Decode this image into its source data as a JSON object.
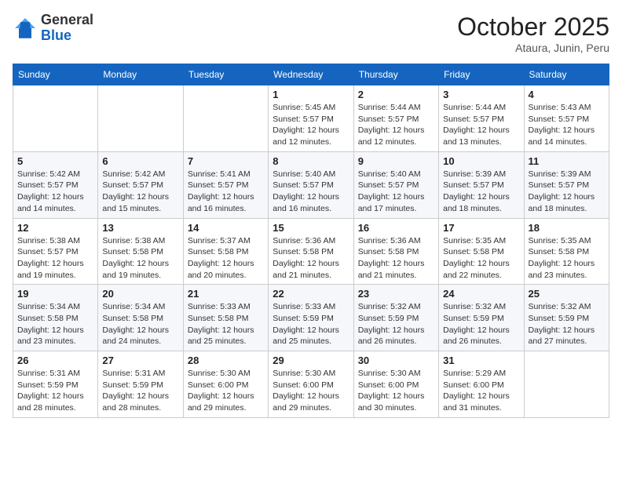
{
  "header": {
    "logo_general": "General",
    "logo_blue": "Blue",
    "month_title": "October 2025",
    "location": "Ataura, Junin, Peru"
  },
  "weekdays": [
    "Sunday",
    "Monday",
    "Tuesday",
    "Wednesday",
    "Thursday",
    "Friday",
    "Saturday"
  ],
  "weeks": [
    [
      {
        "day": "",
        "info": ""
      },
      {
        "day": "",
        "info": ""
      },
      {
        "day": "",
        "info": ""
      },
      {
        "day": "1",
        "info": "Sunrise: 5:45 AM\nSunset: 5:57 PM\nDaylight: 12 hours\nand 12 minutes."
      },
      {
        "day": "2",
        "info": "Sunrise: 5:44 AM\nSunset: 5:57 PM\nDaylight: 12 hours\nand 12 minutes."
      },
      {
        "day": "3",
        "info": "Sunrise: 5:44 AM\nSunset: 5:57 PM\nDaylight: 12 hours\nand 13 minutes."
      },
      {
        "day": "4",
        "info": "Sunrise: 5:43 AM\nSunset: 5:57 PM\nDaylight: 12 hours\nand 14 minutes."
      }
    ],
    [
      {
        "day": "5",
        "info": "Sunrise: 5:42 AM\nSunset: 5:57 PM\nDaylight: 12 hours\nand 14 minutes."
      },
      {
        "day": "6",
        "info": "Sunrise: 5:42 AM\nSunset: 5:57 PM\nDaylight: 12 hours\nand 15 minutes."
      },
      {
        "day": "7",
        "info": "Sunrise: 5:41 AM\nSunset: 5:57 PM\nDaylight: 12 hours\nand 16 minutes."
      },
      {
        "day": "8",
        "info": "Sunrise: 5:40 AM\nSunset: 5:57 PM\nDaylight: 12 hours\nand 16 minutes."
      },
      {
        "day": "9",
        "info": "Sunrise: 5:40 AM\nSunset: 5:57 PM\nDaylight: 12 hours\nand 17 minutes."
      },
      {
        "day": "10",
        "info": "Sunrise: 5:39 AM\nSunset: 5:57 PM\nDaylight: 12 hours\nand 18 minutes."
      },
      {
        "day": "11",
        "info": "Sunrise: 5:39 AM\nSunset: 5:57 PM\nDaylight: 12 hours\nand 18 minutes."
      }
    ],
    [
      {
        "day": "12",
        "info": "Sunrise: 5:38 AM\nSunset: 5:57 PM\nDaylight: 12 hours\nand 19 minutes."
      },
      {
        "day": "13",
        "info": "Sunrise: 5:38 AM\nSunset: 5:58 PM\nDaylight: 12 hours\nand 19 minutes."
      },
      {
        "day": "14",
        "info": "Sunrise: 5:37 AM\nSunset: 5:58 PM\nDaylight: 12 hours\nand 20 minutes."
      },
      {
        "day": "15",
        "info": "Sunrise: 5:36 AM\nSunset: 5:58 PM\nDaylight: 12 hours\nand 21 minutes."
      },
      {
        "day": "16",
        "info": "Sunrise: 5:36 AM\nSunset: 5:58 PM\nDaylight: 12 hours\nand 21 minutes."
      },
      {
        "day": "17",
        "info": "Sunrise: 5:35 AM\nSunset: 5:58 PM\nDaylight: 12 hours\nand 22 minutes."
      },
      {
        "day": "18",
        "info": "Sunrise: 5:35 AM\nSunset: 5:58 PM\nDaylight: 12 hours\nand 23 minutes."
      }
    ],
    [
      {
        "day": "19",
        "info": "Sunrise: 5:34 AM\nSunset: 5:58 PM\nDaylight: 12 hours\nand 23 minutes."
      },
      {
        "day": "20",
        "info": "Sunrise: 5:34 AM\nSunset: 5:58 PM\nDaylight: 12 hours\nand 24 minutes."
      },
      {
        "day": "21",
        "info": "Sunrise: 5:33 AM\nSunset: 5:58 PM\nDaylight: 12 hours\nand 25 minutes."
      },
      {
        "day": "22",
        "info": "Sunrise: 5:33 AM\nSunset: 5:59 PM\nDaylight: 12 hours\nand 25 minutes."
      },
      {
        "day": "23",
        "info": "Sunrise: 5:32 AM\nSunset: 5:59 PM\nDaylight: 12 hours\nand 26 minutes."
      },
      {
        "day": "24",
        "info": "Sunrise: 5:32 AM\nSunset: 5:59 PM\nDaylight: 12 hours\nand 26 minutes."
      },
      {
        "day": "25",
        "info": "Sunrise: 5:32 AM\nSunset: 5:59 PM\nDaylight: 12 hours\nand 27 minutes."
      }
    ],
    [
      {
        "day": "26",
        "info": "Sunrise: 5:31 AM\nSunset: 5:59 PM\nDaylight: 12 hours\nand 28 minutes."
      },
      {
        "day": "27",
        "info": "Sunrise: 5:31 AM\nSunset: 5:59 PM\nDaylight: 12 hours\nand 28 minutes."
      },
      {
        "day": "28",
        "info": "Sunrise: 5:30 AM\nSunset: 6:00 PM\nDaylight: 12 hours\nand 29 minutes."
      },
      {
        "day": "29",
        "info": "Sunrise: 5:30 AM\nSunset: 6:00 PM\nDaylight: 12 hours\nand 29 minutes."
      },
      {
        "day": "30",
        "info": "Sunrise: 5:30 AM\nSunset: 6:00 PM\nDaylight: 12 hours\nand 30 minutes."
      },
      {
        "day": "31",
        "info": "Sunrise: 5:29 AM\nSunset: 6:00 PM\nDaylight: 12 hours\nand 31 minutes."
      },
      {
        "day": "",
        "info": ""
      }
    ]
  ]
}
